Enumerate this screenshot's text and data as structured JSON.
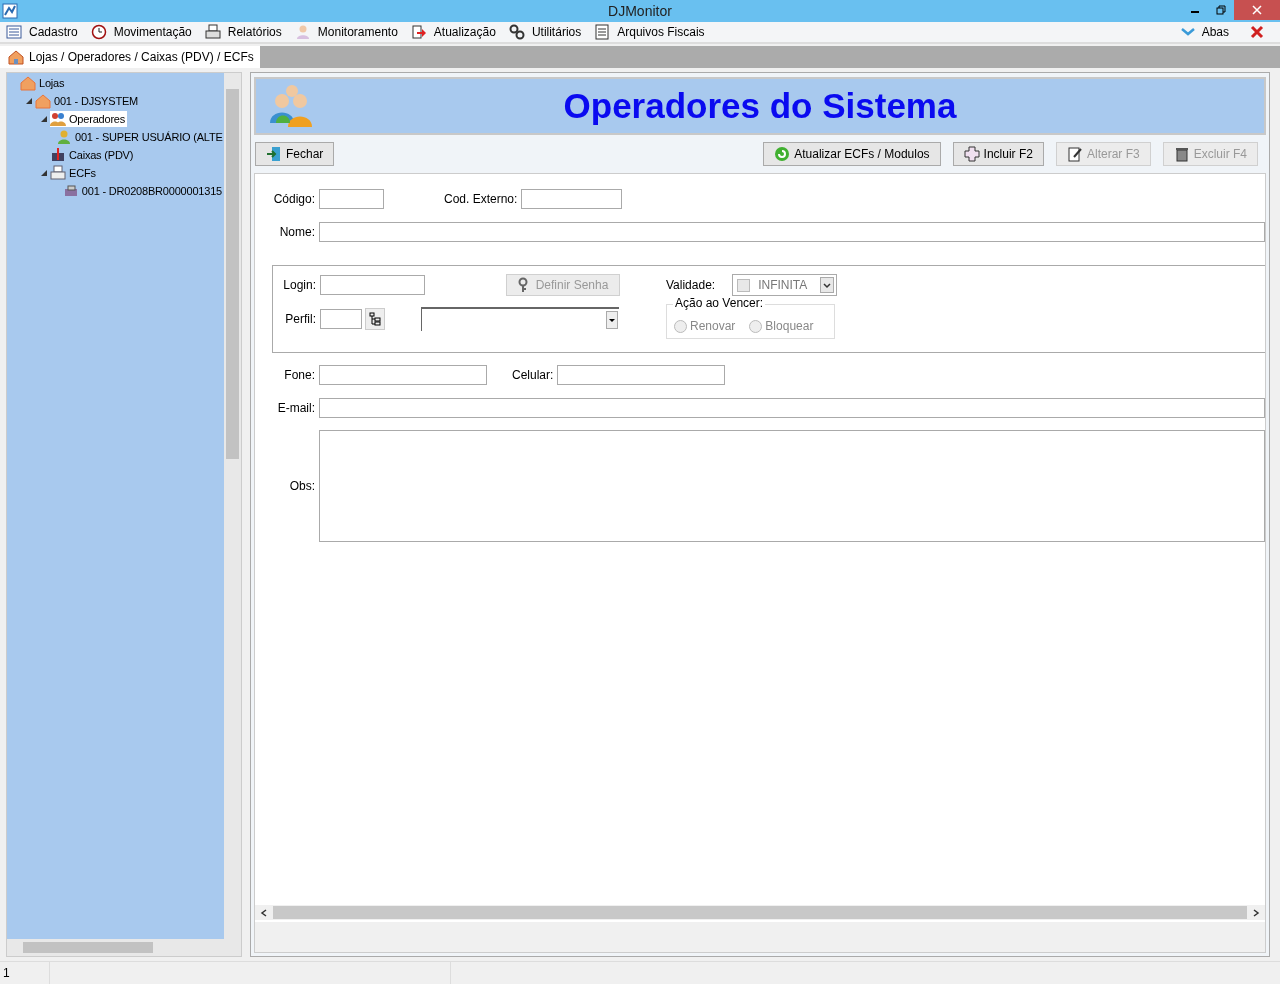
{
  "window": {
    "title": "DJMonitor"
  },
  "menu": [
    {
      "label": "Cadastro"
    },
    {
      "label": "Movimentação"
    },
    {
      "label": "Relatórios"
    },
    {
      "label": "Monitoramento"
    },
    {
      "label": "Atualização"
    },
    {
      "label": "Utilitários"
    },
    {
      "label": "Arquivos Fiscais"
    }
  ],
  "tabs_button": {
    "label": "Abas"
  },
  "tabs": [
    {
      "label": "Lojas / Operadores / Caixas (PDV) / ECFs",
      "selected": true
    }
  ],
  "tree": [
    {
      "label": "Lojas",
      "kind": "store",
      "selected": false,
      "children": [
        {
          "label": "001 - DJSYSTEM",
          "kind": "store",
          "selected": false,
          "expanded": true,
          "children": [
            {
              "label": "Operadores",
              "kind": "group",
              "selected": true,
              "expanded": true,
              "children": [
                {
                  "label": "001 - SUPER USUÁRIO (ALTE",
                  "kind": "user",
                  "selected": false
                }
              ]
            },
            {
              "label": "Caixas (PDV)",
              "kind": "register",
              "selected": false
            },
            {
              "label": "ECFs",
              "kind": "printer",
              "selected": false,
              "expanded": true,
              "children": [
                {
                  "label": "001 - DR0208BR0000001315",
                  "kind": "device",
                  "selected": false
                }
              ]
            }
          ]
        }
      ]
    }
  ],
  "header": {
    "title": "Operadores do Sistema"
  },
  "toolbar": {
    "close": {
      "label": "Fechar"
    },
    "actions": [
      {
        "label": "Atualizar ECFs / Modulos",
        "disabled": false
      },
      {
        "label": "Incluir F2",
        "disabled": false
      },
      {
        "label": "Alterar F3",
        "disabled": true
      },
      {
        "label": "Excluir F4",
        "disabled": true
      }
    ]
  },
  "form": {
    "codigo": {
      "label": "Código:"
    },
    "cod_externo": {
      "label": "Cod. Externo:"
    },
    "nome": {
      "label": "Nome:"
    },
    "login": {
      "label": "Login:"
    },
    "definir_senha": {
      "label": "Definir Senha",
      "disabled": true
    },
    "validade": {
      "label": "Validade:",
      "value": "INFINITA",
      "checked": false,
      "disabled": true
    },
    "perfil": {
      "label": "Perfil:"
    },
    "acao": {
      "label": "Ação ao Vencer:",
      "options": [
        {
          "label": "Renovar",
          "selected": false,
          "disabled": true
        },
        {
          "label": "Bloquear",
          "selected": false,
          "disabled": true
        }
      ]
    },
    "fone": {
      "label": "Fone:"
    },
    "celular": {
      "label": "Celular:"
    },
    "email": {
      "label": "E-mail:"
    },
    "obs": {
      "label": "Obs:"
    }
  },
  "status_bar": [
    "1"
  ]
}
